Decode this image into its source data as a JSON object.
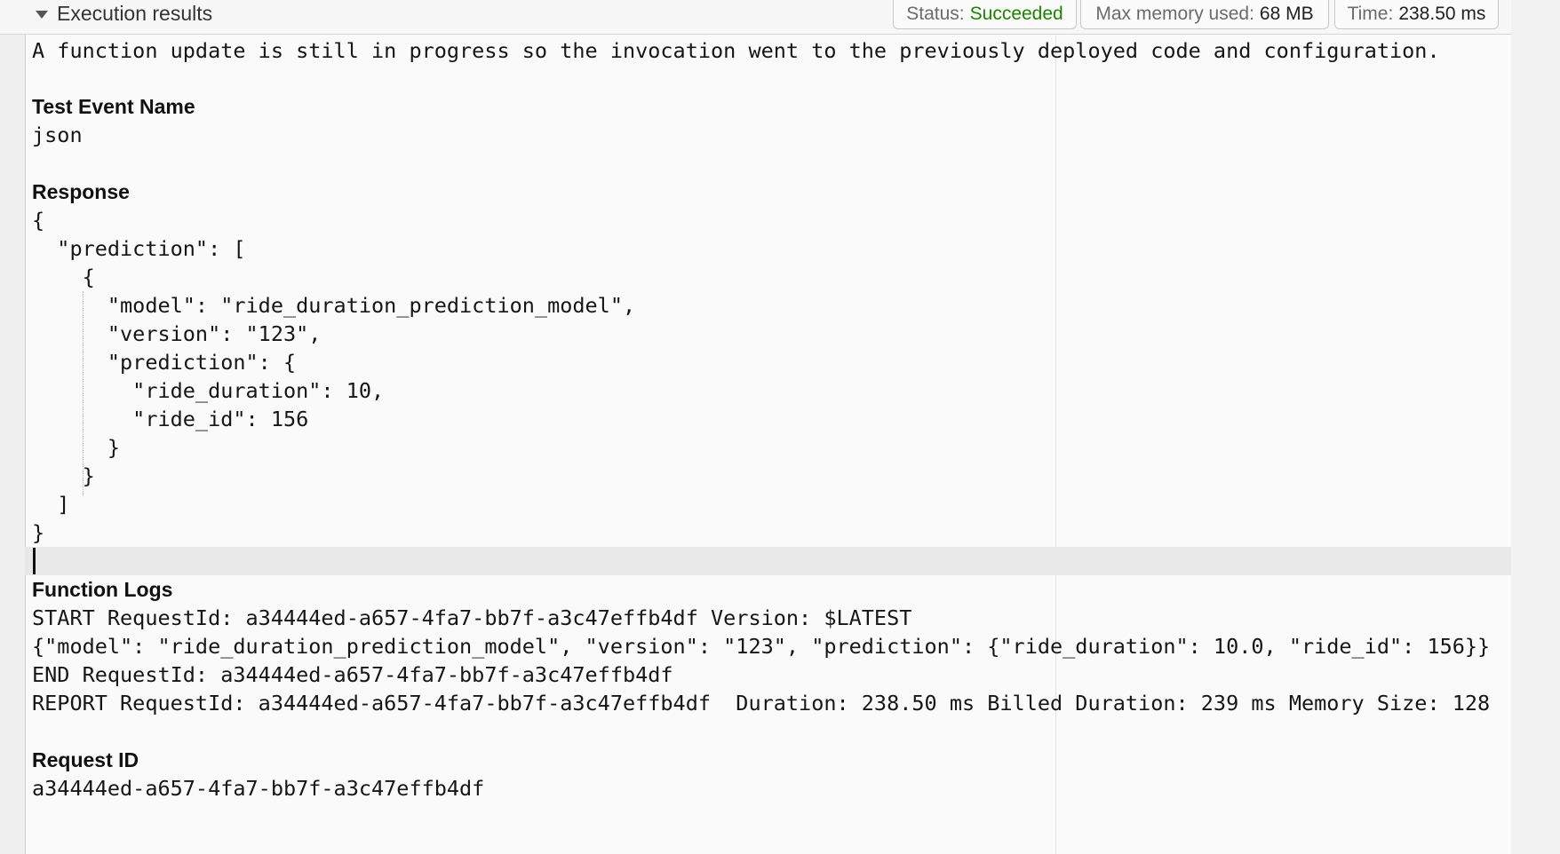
{
  "header": {
    "section_title": "Execution results",
    "status_label": "Status:",
    "status_value": "Succeeded",
    "memory_label": "Max memory used:",
    "memory_value": "68 MB",
    "time_label": "Time:",
    "time_value": "238.50 ms"
  },
  "notice": "A function update is still in progress so the invocation went to the previously deployed code and configuration.",
  "test_event": {
    "label": "Test Event Name",
    "value": "json"
  },
  "response": {
    "label": "Response",
    "body": "{\n  \"prediction\": [\n    {\n      \"model\": \"ride_duration_prediction_model\",\n      \"version\": \"123\",\n      \"prediction\": {\n        \"ride_duration\": 10,\n        \"ride_id\": 156\n      }\n    }\n  ]\n}"
  },
  "function_logs": {
    "label": "Function Logs",
    "body": "START RequestId: a34444ed-a657-4fa7-bb7f-a3c47effb4df Version: $LATEST\n{\"model\": \"ride_duration_prediction_model\", \"version\": \"123\", \"prediction\": {\"ride_duration\": 10.0, \"ride_id\": 156}}\nEND RequestId: a34444ed-a657-4fa7-bb7f-a3c47effb4df\nREPORT RequestId: a34444ed-a657-4fa7-bb7f-a3c47effb4df  Duration: 238.50 ms Billed Duration: 239 ms Memory Size: 128"
  },
  "request_id": {
    "label": "Request ID",
    "value": "a34444ed-a657-4fa7-bb7f-a3c47effb4df"
  },
  "colors": {
    "status_success": "#1d8102",
    "panel_background": "#fafafa",
    "cursor_line_highlight": "#e8e8e8"
  }
}
